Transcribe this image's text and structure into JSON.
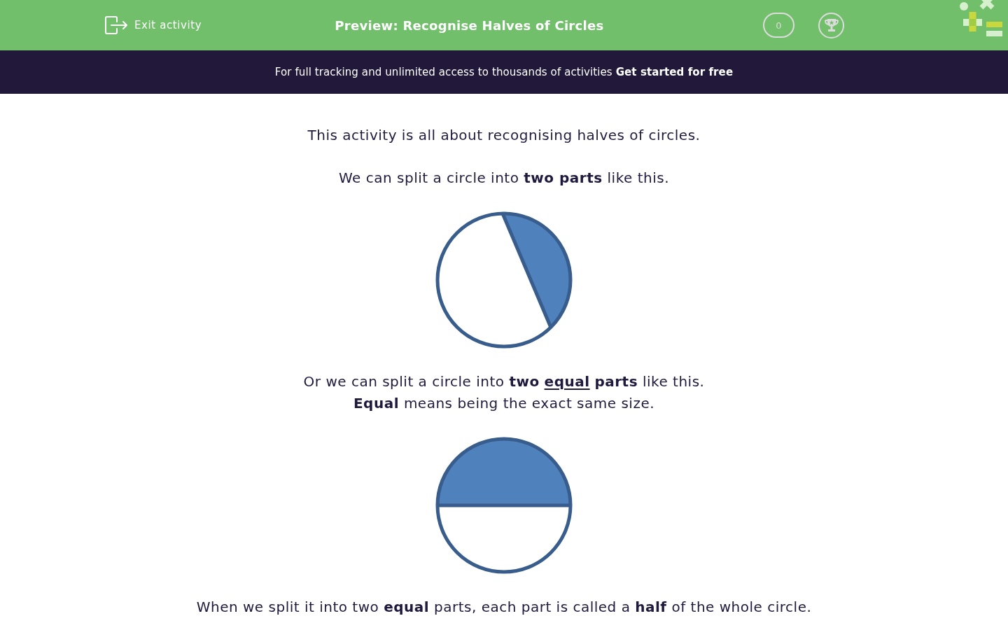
{
  "header": {
    "exit_button": "Exit activity",
    "title": "Preview: Recognise Halves of Circles",
    "score": "0"
  },
  "banner": {
    "message": "For full tracking and unlimited access to thousands of activities",
    "link": "Get started for free"
  },
  "content": [
    {
      "kind": "text",
      "lines": [
        {
          "runs": [
            {
              "text": "This activity is all about recognising halves of circles.",
              "underline": false
            }
          ]
        }
      ]
    },
    {
      "kind": "text",
      "lines": [
        {
          "runs": [
            {
              "text": "We can split a circle into **two parts** like this.",
              "underline": false
            }
          ]
        }
      ]
    },
    {
      "kind": "unequal-split-circle"
    },
    {
      "kind": "text",
      "lines": [
        {
          "runs": [
            {
              "text": "Or we can split a circle into **two** ",
              "underline": false
            },
            {
              "text": "**equal**",
              "underline": true
            },
            {
              "text": " **parts** like this.",
              "underline": false
            }
          ]
        },
        {
          "runs": [
            {
              "text": "**Equal** means being the exact same size.",
              "underline": false
            }
          ]
        }
      ]
    },
    {
      "kind": "halved-circle"
    },
    {
      "kind": "text",
      "lines": [
        {
          "runs": [
            {
              "text": "When we split it into two **equal** parts, each part is called a **half** of the whole circle.",
              "underline": false
            }
          ]
        }
      ]
    }
  ]
}
